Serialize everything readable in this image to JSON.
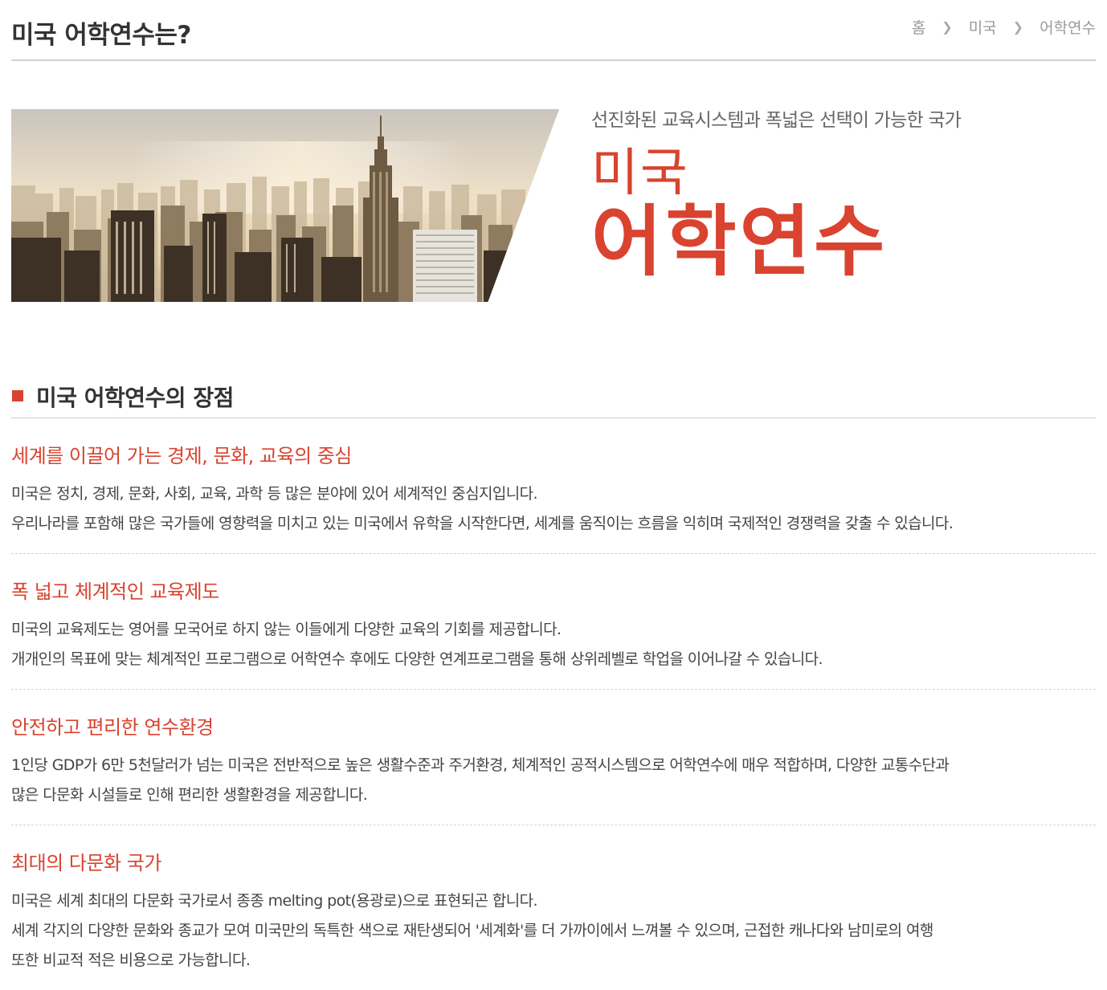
{
  "header": {
    "title": "미국 어학연수는?",
    "breadcrumb": [
      "홈",
      "미국",
      "어학연수"
    ]
  },
  "banner": {
    "subtitle": "선진화된 교육시스템과 폭넓은 선택이 가능한 국가",
    "country": "미국",
    "program": "어학연수"
  },
  "section": {
    "heading": "미국 어학연수의 장점",
    "items": [
      {
        "title": "세계를 이끌어 가는 경제, 문화, 교육의 중심",
        "lines": [
          "미국은 정치, 경제, 문화, 사회, 교육, 과학 등 많은 분야에 있어 세계적인 중심지입니다.",
          "우리나라를 포함해 많은 국가들에 영향력을 미치고 있는 미국에서 유학을 시작한다면, 세계를 움직이는 흐름을 익히며 국제적인 경쟁력을 갖출 수 있습니다."
        ]
      },
      {
        "title": "폭 넓고 체계적인 교육제도",
        "lines": [
          "미국의 교육제도는 영어를 모국어로 하지 않는 이들에게 다양한 교육의 기회를 제공합니다.",
          "개개인의 목표에 맞는 체계적인 프로그램으로 어학연수 후에도 다양한 연계프로그램을 통해 상위레벨로 학업을 이어나갈 수 있습니다."
        ]
      },
      {
        "title": "안전하고 편리한 연수환경",
        "lines": [
          "1인당 GDP가 6만 5천달러가 넘는 미국은 전반적으로 높은 생활수준과 주거환경, 체계적인 공적시스템으로 어학연수에 매우 적합하며, 다양한 교통수단과",
          "많은 다문화 시설들로 인해 편리한 생활환경을 제공합니다."
        ]
      },
      {
        "title": "최대의 다문화 국가",
        "lines": [
          "미국은 세계 최대의 다문화 국가로서 종종 melting pot(용광로)으로 표현되곤 합니다.",
          "세계 각지의 다양한 문화와 종교가 모여 미국만의 독특한 색으로 재탄생되어 '세계화'를 더 가까이에서 느껴볼 수 있으며, 근접한 캐나다와 남미로의 여행",
          "또한 비교적 적은 비용으로 가능합니다."
        ]
      }
    ]
  },
  "colors": {
    "accent": "#d9432f",
    "text": "#444444",
    "muted": "#999999"
  }
}
